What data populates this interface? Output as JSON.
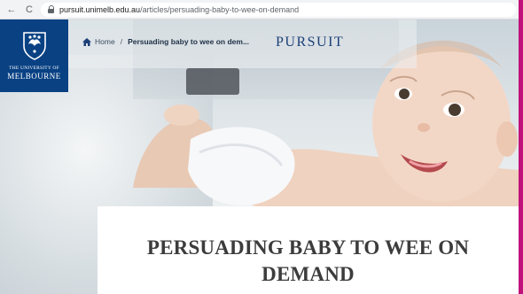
{
  "browser": {
    "reload_glyph": "C",
    "back_glyph": "←",
    "url_host": "pursuit.unimelb.edu.au",
    "url_path": "/articles/persuading-baby-to-wee-on-demand"
  },
  "logo": {
    "line1": "THE UNIVERSITY OF",
    "line2": "MELBOURNE"
  },
  "breadcrumb": {
    "home": "Home",
    "separator": "/",
    "current": "Persuading baby to wee on dem..."
  },
  "brand": "PURSUIT",
  "article": {
    "title": "PERSUADING BABY TO WEE ON DEMAND"
  },
  "colors": {
    "logo_bg": "#094183",
    "brand_text": "#1b3f78",
    "side_accent": "#c1117a"
  },
  "icons": [
    "back-icon",
    "reload-icon",
    "lock-icon",
    "home-icon",
    "crest-icon"
  ]
}
